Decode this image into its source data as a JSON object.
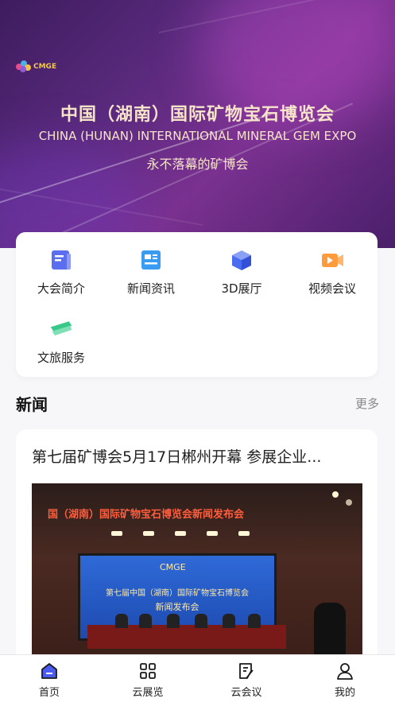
{
  "banner": {
    "logo_text": "CMGE",
    "title": "中国（湖南）国际矿物宝石博览会",
    "subtitle_en": "CHINA (HUNAN) INTERNATIONAL MINERAL GEM EXPO",
    "slogan": "永不落幕的矿博会"
  },
  "menu": {
    "items": [
      {
        "label": "大会简介",
        "icon": "document-icon",
        "color": "#5b6ef0"
      },
      {
        "label": "新闻资讯",
        "icon": "news-icon",
        "color": "#3a9cf0"
      },
      {
        "label": "3D展厅",
        "icon": "cube-icon",
        "color": "#4a6cf0"
      },
      {
        "label": "视频会议",
        "icon": "video-icon",
        "color": "#ff9b3b"
      },
      {
        "label": "文旅服务",
        "icon": "ticket-icon",
        "color": "#38c98a"
      }
    ]
  },
  "news": {
    "heading": "新闻",
    "more": "更多",
    "items": [
      {
        "title": "第七届矿博会5月17日郴州开幕 参展企业...",
        "image_banner_text": "国（湖南）国际矿物宝石博览会新闻发布会",
        "image_screen_line1": "第七届中国（湖南）国际矿物宝石博览会",
        "image_screen_line2": "新闻发布会"
      }
    ]
  },
  "tabbar": {
    "items": [
      {
        "label": "首页",
        "icon": "home-icon",
        "active": true
      },
      {
        "label": "云展览",
        "icon": "grid-icon",
        "active": false
      },
      {
        "label": "云会议",
        "icon": "meeting-icon",
        "active": false
      },
      {
        "label": "我的",
        "icon": "user-icon",
        "active": false
      }
    ]
  },
  "colors": {
    "banner_text": "#f6e4c9",
    "active_tab": "#4a5cf0"
  }
}
